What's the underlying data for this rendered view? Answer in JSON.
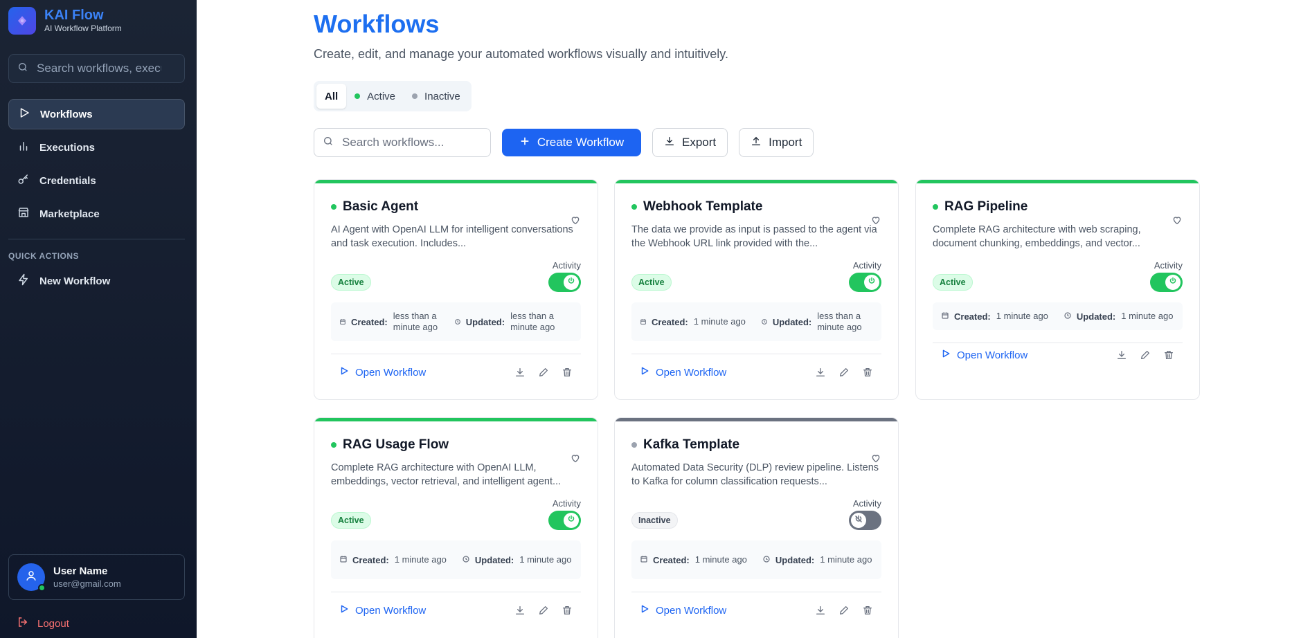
{
  "brand": {
    "title": "KAI Flow",
    "subtitle": "AI Workflow Platform"
  },
  "sidebar": {
    "search_placeholder": "Search workflows, executions...",
    "items": [
      {
        "label": "Workflows",
        "icon": "play-icon",
        "active": true
      },
      {
        "label": "Executions",
        "icon": "bar-chart-icon"
      },
      {
        "label": "Credentials",
        "icon": "key-icon"
      },
      {
        "label": "Marketplace",
        "icon": "store-icon"
      }
    ],
    "quick_actions_title": "QUICK ACTIONS",
    "quick_actions": [
      {
        "label": "New Workflow",
        "icon": "lightning-icon"
      }
    ],
    "user": {
      "name": "User Name",
      "email": "user@gmail.com"
    },
    "logout_label": "Logout"
  },
  "header": {
    "title": "Workflows",
    "subtitle": "Create, edit, and manage your automated workflows visually and intuitively."
  },
  "filters": [
    {
      "label": "All",
      "active": true
    },
    {
      "label": "Active",
      "dot_color": "#22c55e"
    },
    {
      "label": "Inactive",
      "dot_color": "#9ca3af"
    }
  ],
  "toolbar": {
    "search_placeholder": "Search workflows...",
    "create_label": "Create Workflow",
    "export_label": "Export",
    "import_label": "Import"
  },
  "card_labels": {
    "activity": "Activity",
    "created": "Created:",
    "updated": "Updated:",
    "open": "Open Workflow"
  },
  "workflows": [
    {
      "title": "Basic Agent",
      "description": "AI Agent with OpenAI LLM for intelligent conversations and task execution. Includes...",
      "status": "Active",
      "created": "less than a minute ago",
      "updated": "less than a minute ago"
    },
    {
      "title": "Webhook Template",
      "description": "The data we provide as input is passed to the agent via the Webhook URL link provided with the...",
      "status": "Active",
      "created": "1 minute ago",
      "updated": "less than a minute ago"
    },
    {
      "title": "RAG Pipeline",
      "description": "Complete RAG architecture with web scraping, document chunking, embeddings, and vector...",
      "status": "Active",
      "created": "1 minute ago",
      "updated": "1 minute ago"
    },
    {
      "title": "RAG Usage Flow",
      "description": "Complete RAG architecture with OpenAI LLM, embeddings, vector retrieval, and intelligent agent...",
      "status": "Active",
      "created": "1 minute ago",
      "updated": "1 minute ago"
    },
    {
      "title": "Kafka Template",
      "description": "Automated Data Security (DLP) review pipeline. Listens to Kafka for column classification requests...",
      "status": "Inactive",
      "created": "1 minute ago",
      "updated": "1 minute ago"
    }
  ],
  "colors": {
    "accent": "#1d64f2",
    "active": "#22c55e",
    "inactive": "#6b7280",
    "sidebar_bg": "#0f172a"
  }
}
